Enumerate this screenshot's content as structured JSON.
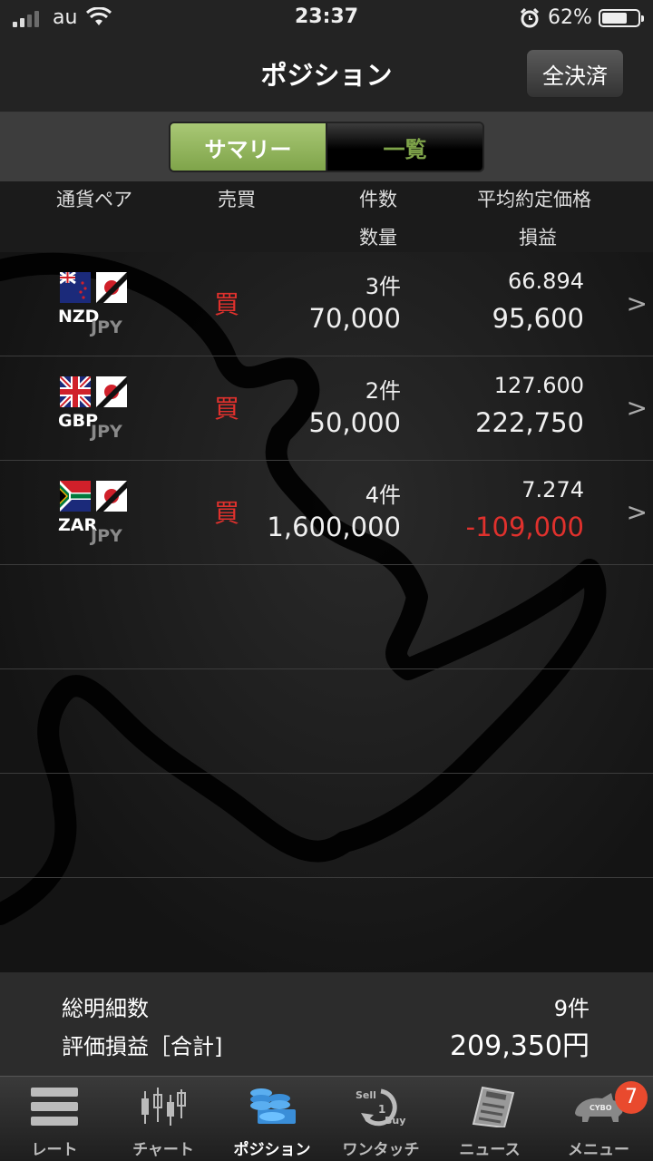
{
  "status_bar": {
    "carrier": "au",
    "time": "23:37",
    "battery_percent": "62%"
  },
  "nav": {
    "title": "ポジション",
    "close_all_button": "全決済"
  },
  "segments": [
    {
      "label": "サマリー",
      "selected": true
    },
    {
      "label": "一覧",
      "selected": false
    }
  ],
  "header": {
    "pair": "通貨ペア",
    "side": "売買",
    "count": "件数",
    "quantity": "数量",
    "avg_price": "平均約定価格",
    "pl": "損益"
  },
  "positions": [
    {
      "base": "NZD",
      "quote": "JPY",
      "side": "買",
      "count": "3件",
      "quantity": "70,000",
      "avg_price": "66.894",
      "pl": "95,600",
      "pl_negative": false
    },
    {
      "base": "GBP",
      "quote": "JPY",
      "side": "買",
      "count": "2件",
      "quantity": "50,000",
      "avg_price": "127.600",
      "pl": "222,750",
      "pl_negative": false
    },
    {
      "base": "ZAR",
      "quote": "JPY",
      "side": "買",
      "count": "4件",
      "quantity": "1,600,000",
      "avg_price": "7.274",
      "pl": "-109,000",
      "pl_negative": true
    }
  ],
  "row_chevron": ">",
  "summary": {
    "total_count_label": "総明細数",
    "total_count_value": "9件",
    "pl_total_label": "評価損益［合計]",
    "pl_total_value": "209,350円"
  },
  "tabs": [
    {
      "label": "レート",
      "icon": "rate-list-icon"
    },
    {
      "label": "チャート",
      "icon": "candlestick-icon"
    },
    {
      "label": "ポジション",
      "icon": "coins-icon",
      "active": true
    },
    {
      "label": "ワンタッチ",
      "icon": "sell-buy-icon"
    },
    {
      "label": "ニュース",
      "icon": "newspaper-icon"
    },
    {
      "label": "メニュー",
      "icon": "rhino-icon"
    }
  ],
  "menu_badge": "7",
  "colors": {
    "accent_green": "#8db35a",
    "sell_buy_red": "#e0312d",
    "background": "#1a1a1a"
  }
}
